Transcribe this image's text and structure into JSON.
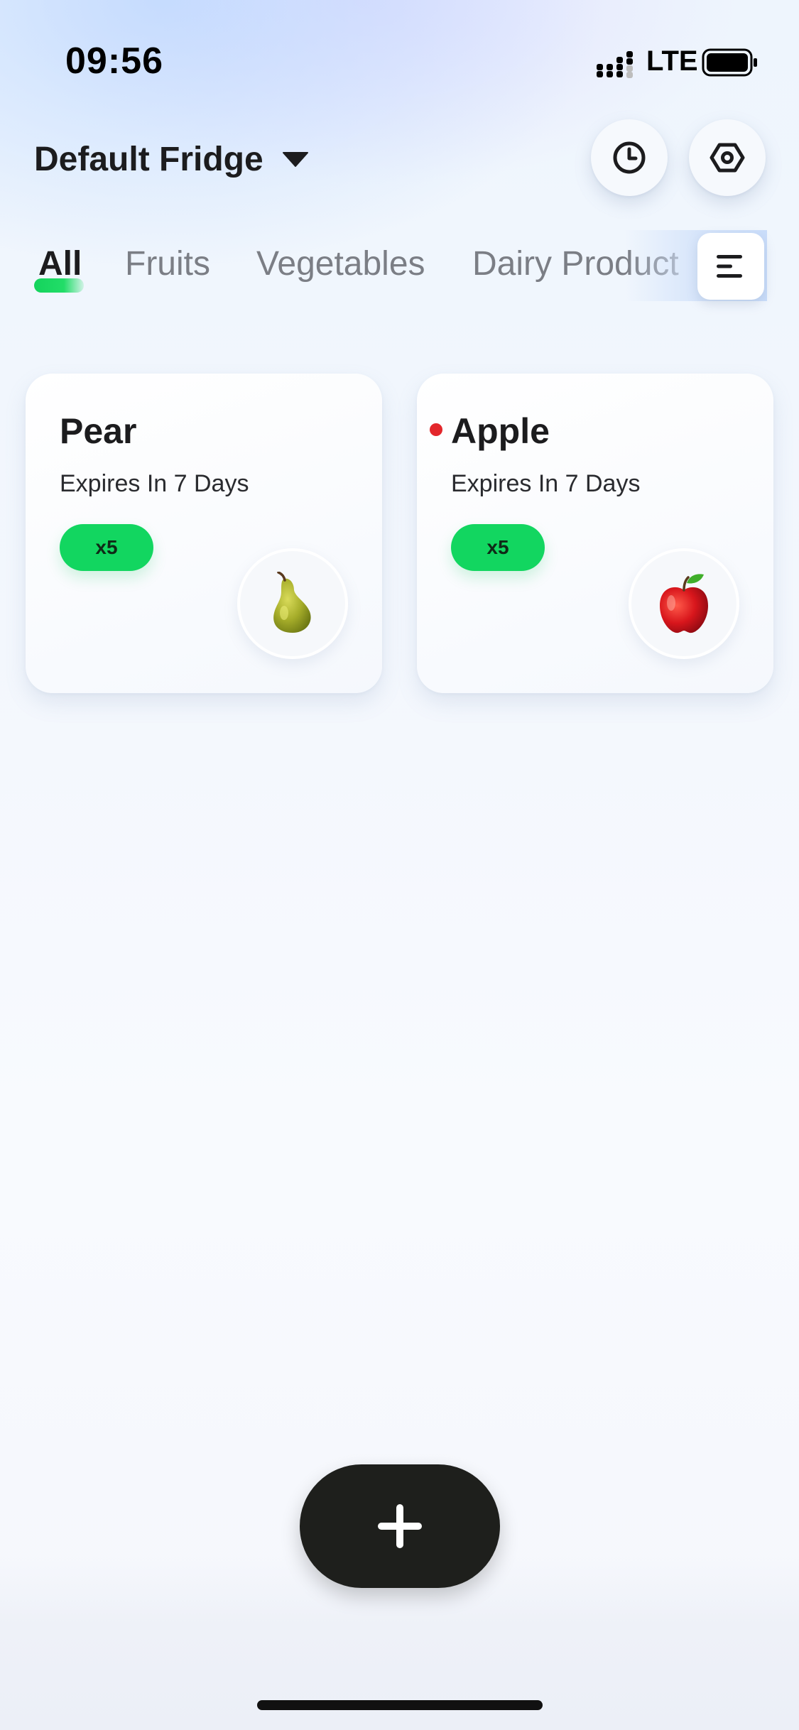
{
  "status_bar": {
    "time": "09:56",
    "network": "LTE",
    "icons": [
      "signal-bars-icon",
      "battery-icon"
    ]
  },
  "header": {
    "fridge_name": "Default Fridge",
    "icons": [
      "caret-down-icon",
      "history-clock-icon",
      "settings-hex-icon"
    ]
  },
  "tabs": {
    "items": [
      "All",
      "Fruits",
      "Vegetables",
      "Dairy Product"
    ],
    "active_index": 0,
    "menu_icon": "menu-lines-icon"
  },
  "items": [
    {
      "name": "Pear",
      "expiry": "Expires In 7 Days",
      "quantity": "x5",
      "icon": "pear-icon",
      "alert_dot": false
    },
    {
      "name": "Apple",
      "expiry": "Expires In 7 Days",
      "quantity": "x5",
      "icon": "apple-icon",
      "alert_dot": true
    }
  ],
  "actions": {
    "add_icon": "plus-icon"
  },
  "colors": {
    "accent_green": "#12d660",
    "alert_red": "#e3262b",
    "dark_button": "#1e1f1c",
    "text_primary": "#1c1c1e",
    "text_secondary": "#7b7e85"
  }
}
